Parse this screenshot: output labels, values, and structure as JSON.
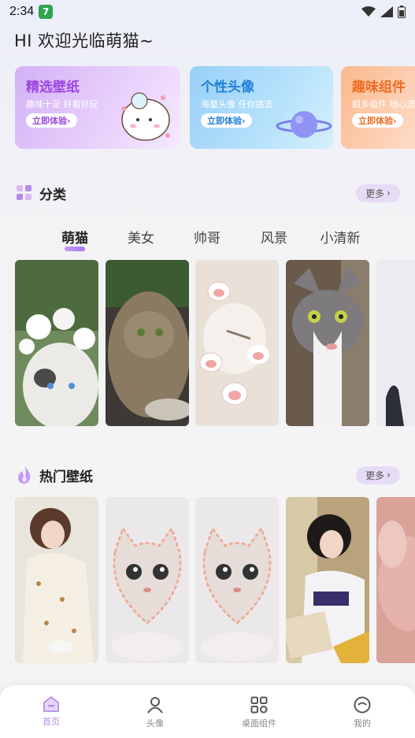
{
  "status_bar": {
    "time": "2:34",
    "app_badge": "7",
    "icons": [
      "wifi-icon",
      "signal-icon",
      "battery-icon"
    ]
  },
  "greeting": "HI 欢迎光临萌猫~",
  "banners": [
    {
      "title": "精选壁纸",
      "subtitle": "趣味十足 好看好玩",
      "button": "立即体验",
      "accent": "#9b47e3",
      "icon": "cute-cat-sticker"
    },
    {
      "title": "个性头像",
      "subtitle": "海量头像 任你挑选",
      "button": "立即体验",
      "accent": "#1e7fd8",
      "icon": "planet-icon"
    },
    {
      "title": "趣味组件",
      "subtitle": "超多组件 随心选",
      "button": "立即体验",
      "accent": "#ee6d23",
      "icon": ""
    }
  ],
  "category_section": {
    "title": "分类",
    "more": "更多",
    "icon": "category-grid-icon",
    "tabs": [
      "萌猫",
      "美女",
      "帅哥",
      "风景",
      "小清新"
    ],
    "active_tab": "萌猫"
  },
  "hot_section": {
    "title": "热门壁纸",
    "more": "更多",
    "icon": "flame-icon"
  },
  "bottom_nav": [
    {
      "label": "首页",
      "icon": "home-icon",
      "active": true
    },
    {
      "label": "头像",
      "icon": "person-icon",
      "active": false
    },
    {
      "label": "桌面组件",
      "icon": "widgets-icon",
      "active": false
    },
    {
      "label": "我的",
      "icon": "profile-face-icon",
      "active": false
    }
  ],
  "colors": {
    "active_accent": "#b78de8",
    "more_pill": "#e6dcf6"
  }
}
